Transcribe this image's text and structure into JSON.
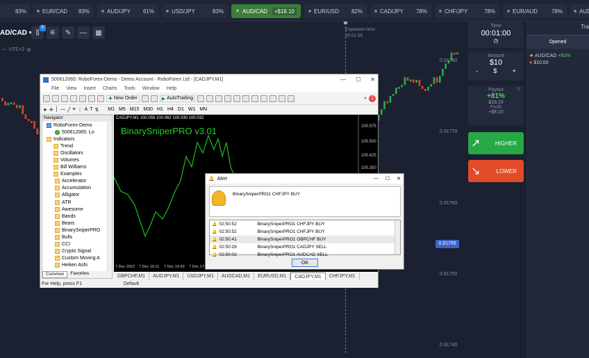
{
  "tickers": [
    {
      "pct": "83%"
    },
    {
      "name": "EUR/CAD",
      "pct": "83%"
    },
    {
      "name": "AUD/JPY",
      "pct": "61%"
    },
    {
      "name": "USD/JPY",
      "pct": "83%"
    },
    {
      "name": "AUD/CAD",
      "pct": "+$18.10",
      "active": true
    },
    {
      "name": "EUR/USD",
      "pct": "82%"
    },
    {
      "name": "CAD/JPY",
      "pct": "78%"
    },
    {
      "name": "CHF/JPY",
      "pct": "78%"
    },
    {
      "name": "EUR/AUD",
      "pct": "78%"
    },
    {
      "name": "AUD"
    }
  ],
  "toolbar": {
    "pair": "AD/CAD",
    "tz": "UTC+2",
    "badge": "5"
  },
  "expiration": {
    "label": "Expiration time",
    "time": "20:51:55"
  },
  "prices": [
    "0.91780",
    "0.91770",
    "0.91760",
    "0.91750",
    "0.91740"
  ],
  "current_price": "0.91755",
  "right": {
    "time_label": "Time",
    "time_value": "00:01:00",
    "amount_label": "Amount",
    "amount_value": "$10",
    "minus": "-",
    "plus": "+",
    "dollar": "$",
    "payout_label": "Payout",
    "payout_pct": "+81%",
    "payout_amt": "$18.10",
    "profit_label": "Profit",
    "profit_amt": "+$8.10",
    "higher": "HIGHER",
    "lower": "LOWER",
    "tab_trades": "Tra",
    "tab_opened": "Opened",
    "trade_pair": "AUD/CAD",
    "trade_pct": "+81%",
    "trade_amt": "$10.00"
  },
  "mt4": {
    "title": "500612065: RoboForex-Demo - Demo Account - RoboForex Ltd - [CADJPY,M1]",
    "menu": [
      "File",
      "View",
      "Insert",
      "Charts",
      "Tools",
      "Window",
      "Help"
    ],
    "new_order": "New Order",
    "autotrading": "AutoTrading",
    "timeframes": [
      "M1",
      "M5",
      "M15",
      "M30",
      "H1",
      "H4",
      "D1",
      "W1",
      "MN"
    ],
    "navigator_title": "Navigator",
    "nav_items": [
      "RoboForex-Demo",
      "500612065: Lo",
      "Indicators",
      "Trend",
      "Oscillators",
      "Volumes",
      "Bill Williams",
      "Examples",
      "Accelerator",
      "Accumulation",
      "Alligator",
      "ATR",
      "Awesome",
      "Bands",
      "Bears",
      "BinarySniperPRO",
      "Bulls",
      "CCI",
      "Crypto Signal",
      "Custom Moving A",
      "Heiken Ashi"
    ],
    "nav_tabs": [
      "Common",
      "Favorites"
    ],
    "chart_header": "CADJPY,M1  100.059 100.062 100.030 100.032",
    "chart_title": "BinarySniperPRO v3.01",
    "axis_prices": [
      "100.575",
      "100.500",
      "100.425",
      "100.350"
    ],
    "axis_times": [
      "7 Dec 2022",
      "7 Dec 16:11",
      "7 Dec 16:43",
      "7 Dec 17:1"
    ],
    "tabs": [
      "GBPCHF,M1",
      "AUDJPY,M1",
      "USDJPY,M1",
      "AUDCAD,M1",
      "EURUSD,M1",
      "CADJPY,M1",
      "CHFJPY,M1"
    ],
    "status_left": "For Help, press F1",
    "status_mid": "Default"
  },
  "alert": {
    "title": "Alert",
    "message": "BinarySniperPRO1 CHFJPY BUY",
    "rows": [
      {
        "time": "02:50:52",
        "text": "BinarySniperPRO1 CHFJPY BUY"
      },
      {
        "time": "02:50:52",
        "text": "BinarySniperPRO1 CHFJPY BUY"
      },
      {
        "time": "02:50:41",
        "text": "BinarySniperPRO1 GBPCHF BUY"
      },
      {
        "time": "02:50:29",
        "text": "BinarySniperPRO1 CADJPY SELL"
      },
      {
        "time": "02:50:02",
        "text": "BinarySniperPRO1 AUDCAD SELL"
      }
    ],
    "ok": "OK"
  },
  "colors": {
    "up": "#2fa84f",
    "down": "#e4412a",
    "higher": "#27a745",
    "lower": "#e14b27",
    "panel": "#232a3b"
  }
}
